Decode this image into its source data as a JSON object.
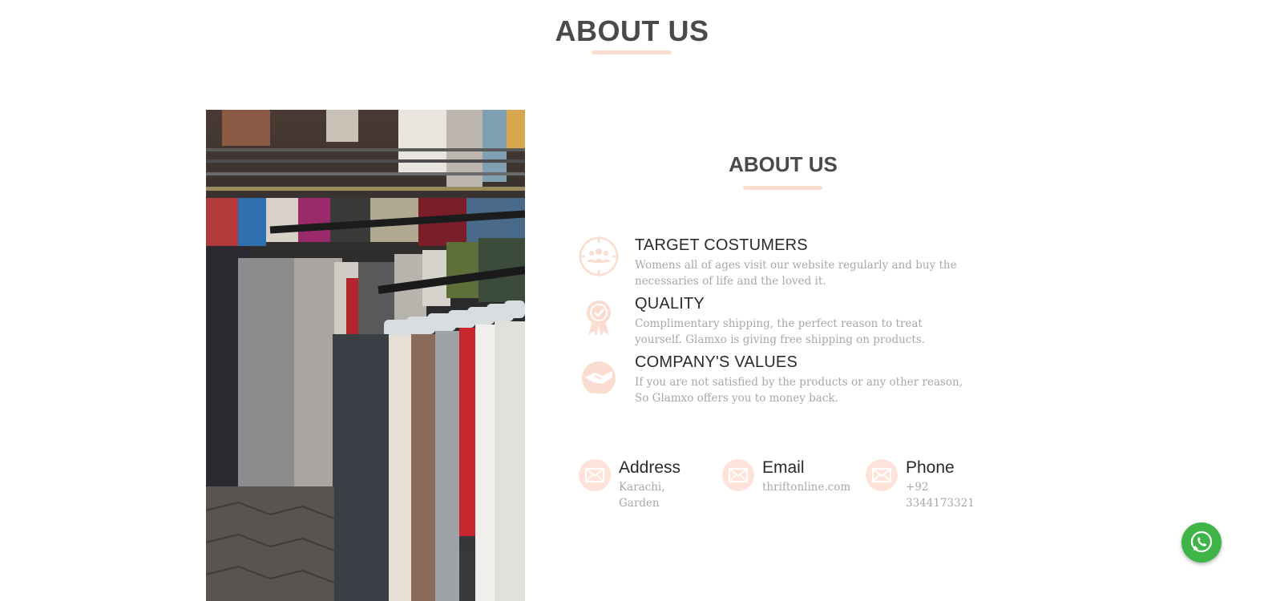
{
  "page": {
    "heading": "ABOUT US"
  },
  "about": {
    "title": "ABOUT US",
    "features": [
      {
        "icon": "target-customers-icon",
        "title": "TARGET COSTUMERS",
        "description": "Womens all of ages visit our website regularly and buy the necessaries of life and the loved it."
      },
      {
        "icon": "quality-badge-icon",
        "title": "QUALITY",
        "description": "Complimentary shipping, the perfect reason to treat yourself. Glamxo is giving free shipping on products."
      },
      {
        "icon": "handshake-icon",
        "title": "COMPANY'S VALUES",
        "description": "If you are not satisfied by the products or any other reason, So Glamxo offers you to money back."
      }
    ]
  },
  "contact": {
    "address": {
      "icon": "envelope-icon",
      "label": "Address",
      "value": "Karachi, Garden"
    },
    "email": {
      "icon": "envelope-icon",
      "label": "Email",
      "value": "thriftonline.com"
    },
    "phone": {
      "icon": "envelope-icon",
      "label": "Phone",
      "value": "+92 3344173321"
    }
  },
  "widgets": {
    "whatsapp": {
      "icon": "whatsapp-icon"
    }
  },
  "colors": {
    "accent": "#fbdcd0",
    "icon_fill": "#fde3d9",
    "heading": "#4a4a4a",
    "muted_text": "#a8a8a8",
    "whatsapp": "#3fb548"
  }
}
